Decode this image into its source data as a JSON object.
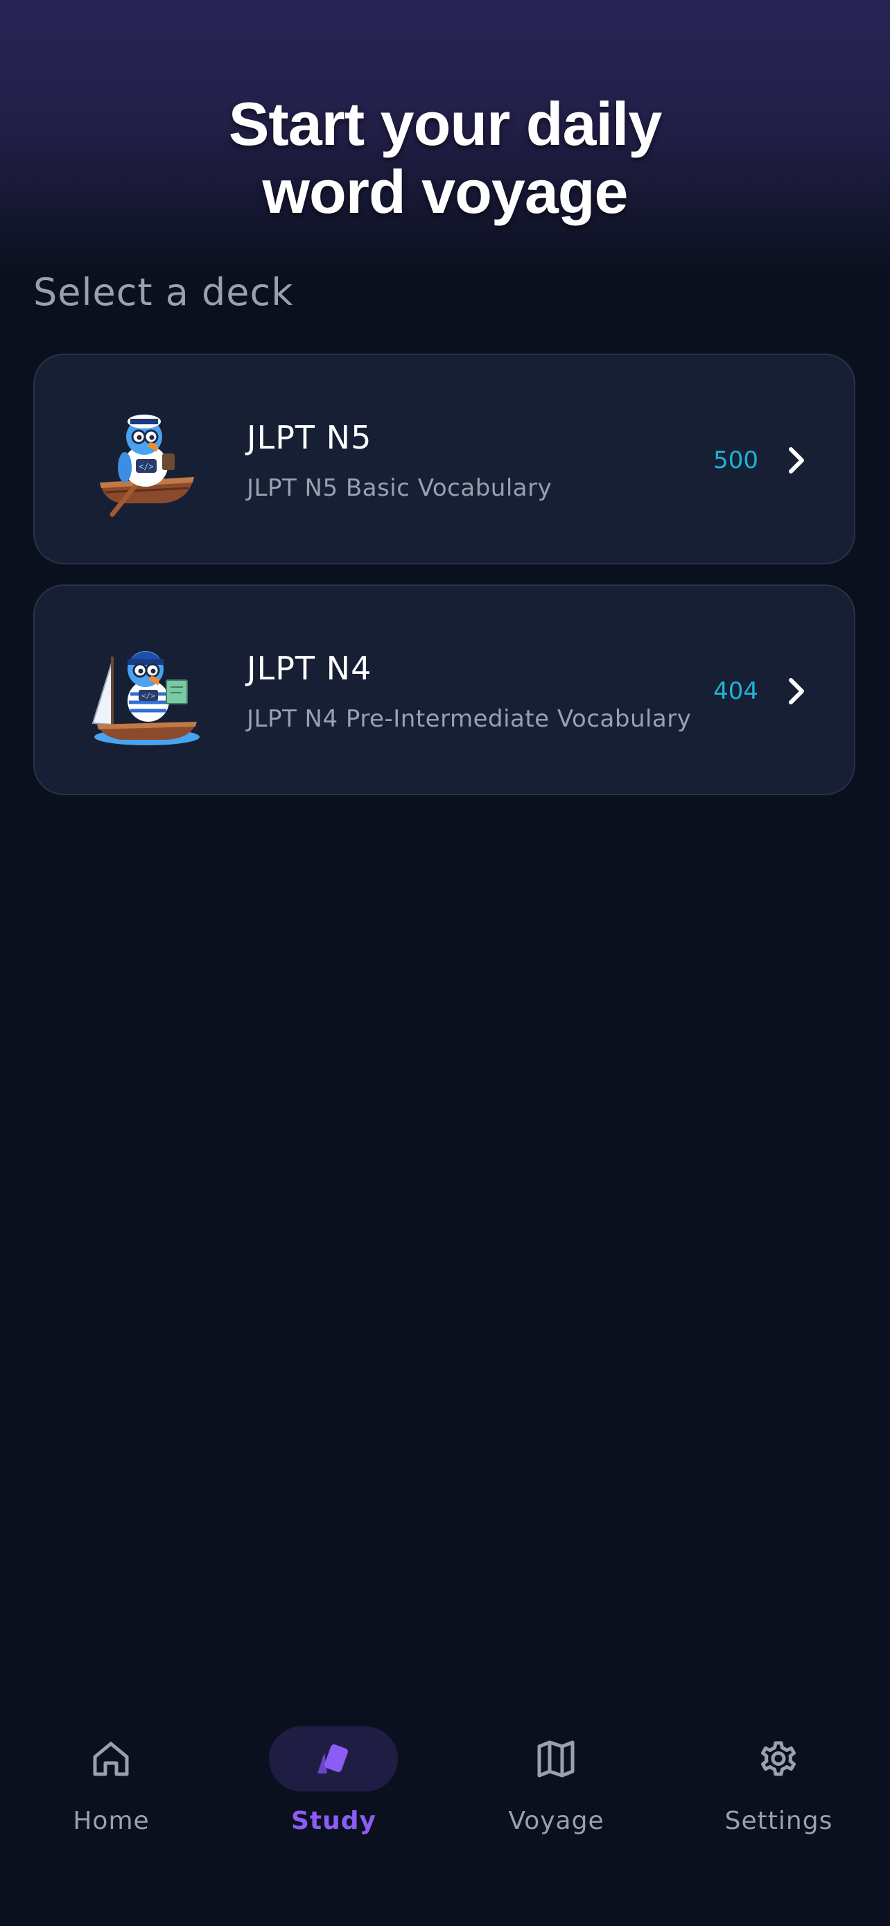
{
  "header": {
    "title_line1": "Start your daily",
    "title_line2": "word voyage"
  },
  "section_label": "Select a deck",
  "decks": [
    {
      "name": "JLPT N5",
      "description": "JLPT N5 Basic Vocabulary",
      "count": "500",
      "image_icon": "parrot-sailor-rowboat-icon"
    },
    {
      "name": "JLPT N4",
      "description": "JLPT N4 Pre-Intermediate Vocabulary",
      "count": "404",
      "image_icon": "parrot-captain-sailboat-icon"
    }
  ],
  "tabbar": {
    "active": "Study",
    "tabs": [
      {
        "label": "Home",
        "icon": "home-icon"
      },
      {
        "label": "Study",
        "icon": "cards-icon"
      },
      {
        "label": "Voyage",
        "icon": "map-icon"
      },
      {
        "label": "Settings",
        "icon": "gear-icon"
      }
    ]
  },
  "colors": {
    "background": "#0b101e",
    "header_gradient_top": "#272455",
    "card_background": "#161f34",
    "card_border": "#283349",
    "muted_text": "#9aa0b0",
    "count_accent": "#1eb4d4",
    "active_tab": "#8b5cf6",
    "active_tab_pill": "#201d45"
  }
}
